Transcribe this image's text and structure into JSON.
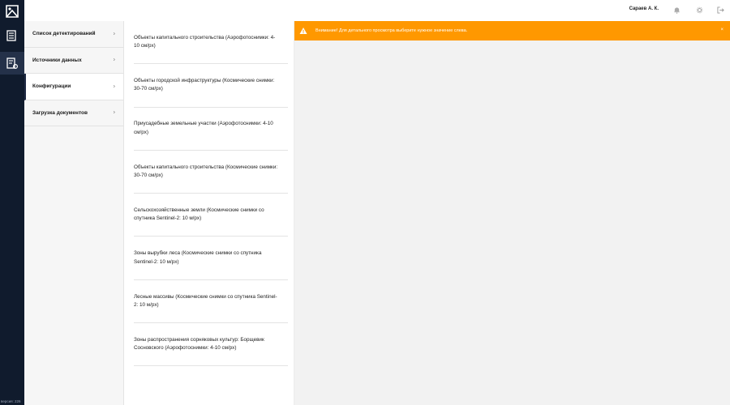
{
  "header": {
    "user_name": "Сараев А. К."
  },
  "sidebar": {
    "version": "версия: 226",
    "items": [
      {
        "label": "Список детектирований",
        "active": false
      },
      {
        "label": "Источники данных",
        "active": false
      },
      {
        "label": "Конфигурации",
        "active": true
      },
      {
        "label": "Загрузка документов",
        "active": false
      }
    ],
    "chevron": "›"
  },
  "configurations": [
    {
      "label": "Объекты капитального строительства (Аэрофотоснимки: 4-10 см/px)"
    },
    {
      "label": "Объекты городской инфраструктуры (Космические снимки: 30-70 см/px)"
    },
    {
      "label": "Приусадебные земельные участки (Аэрофотоснимки: 4-10 см/px)"
    },
    {
      "label": "Объекты капитального строительства (Космические снимки: 30-70 см/px)"
    },
    {
      "label": "Сельскохозяйственные земли (Космические снимки со спутника Sentinel-2: 10 м/px)"
    },
    {
      "label": "Зоны вырубки леса (Космические снимки со спутника Sentinel-2: 10 м/px)"
    },
    {
      "label": "Лесные массивы (Космические снимки со спутника Sentinel-2: 10 м/px)"
    },
    {
      "label": "Зоны распространения сорняковых культур: Борщевик Сосновского (Аэрофотоснимки: 4-10 см/px)"
    }
  ],
  "alert": {
    "message": "Внимание! Для детального просмотра выберите нужное значение слева.",
    "close": "×",
    "color": "#ff9800"
  },
  "colors": {
    "rail": "#101b2d",
    "accent": "#1f2a44"
  }
}
